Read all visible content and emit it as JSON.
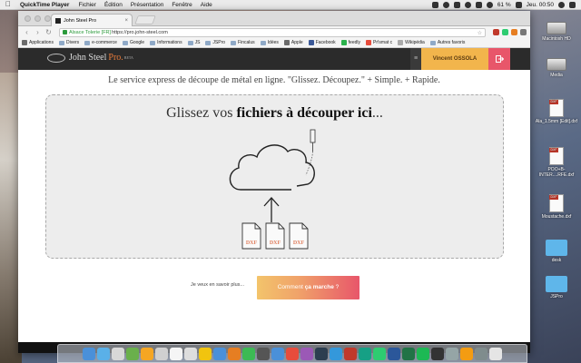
{
  "menubar": {
    "app_name": "QuickTime Player",
    "menus": [
      "Fichier",
      "Édition",
      "Présentation",
      "Fenêtre",
      "Aide"
    ],
    "battery": "61 %",
    "clock": "Jeu. 00:50"
  },
  "browser": {
    "tab_title": "John Steel Pro",
    "secure_label": "Alsace Tolerie [FR]",
    "url": "https://pro.john-steel.com",
    "bookmarks": [
      "Applications",
      "Divers",
      "e-commerce",
      "Google",
      "Informations",
      "JS",
      "JSPro",
      "Fincalus",
      "Idées",
      "Apple",
      "Facebook",
      "feedly",
      "Pr!smat c",
      "Wikipédia",
      "Autres favoris"
    ]
  },
  "site": {
    "logo_text": "John Steel",
    "logo_pro": "Pro.",
    "logo_beta": "BETA",
    "menu_icon": "≡",
    "user_name": "Vincent OSSOLA",
    "logout_icon": "logout-icon",
    "tagline": "Le service express de découpe de métal en ligne. \"Glissez. Découpez.\" + Simple. + Rapide.",
    "drop_title_pre": "Glissez vos ",
    "drop_title_bold": "fichiers à découper ici",
    "drop_title_post": "...",
    "file_label": "DXF",
    "learn_more": "Je veux en savoir plus...",
    "how_pre": "Comment ",
    "how_bold": "ça marche",
    "how_post": " ?",
    "accent": "#e97b3a",
    "user_color": "#f2b54c",
    "logout_color": "#e8566a"
  },
  "desktop": {
    "icons": [
      {
        "label": "Macintosh HD",
        "type": "hdd"
      },
      {
        "label": "Media",
        "type": "hdd"
      },
      {
        "label": "Ala_1.5mm [Edit].dxf",
        "type": "doc"
      },
      {
        "label": "POO+B-INTER....RFE.dxf",
        "type": "doc"
      },
      {
        "label": "Moustache.dxf",
        "type": "doc"
      },
      {
        "label": "desk",
        "type": "folder"
      },
      {
        "label": "JSPro",
        "type": "folder"
      }
    ],
    "doc_tag": "DXF"
  },
  "dock": {
    "colors": [
      "#4a90d9",
      "#5ab0e8",
      "#d8d8d8",
      "#6ab04c",
      "#f5a623",
      "#d0d0d0",
      "#f5f5f5",
      "#dddddd",
      "#f1c40f",
      "#4a90d9",
      "#e67e22",
      "#3cba54",
      "#555555",
      "#4a90d9",
      "#e74c3c",
      "#9b59b6",
      "#2c3e50",
      "#3498db",
      "#c0392b",
      "#16a085",
      "#2ecc71",
      "#2b579a",
      "#217346",
      "#1db954",
      "#333333",
      "#95a5a6",
      "#f39c12",
      "#7f8c8d",
      "#e5e5e5"
    ]
  }
}
